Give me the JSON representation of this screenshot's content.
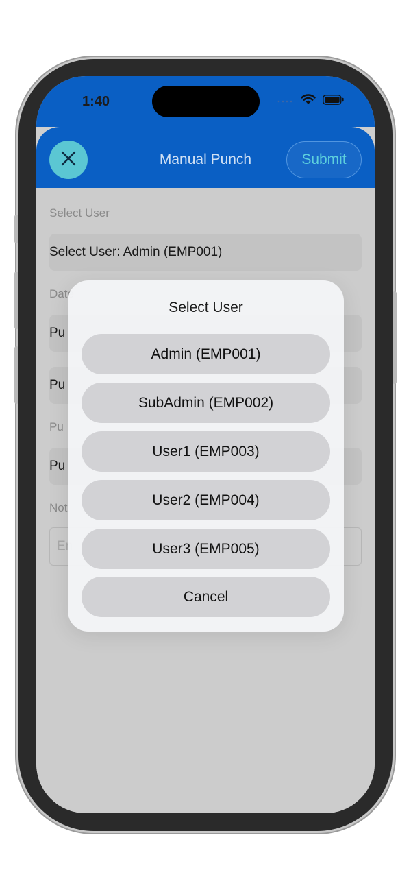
{
  "status_bar": {
    "time": "1:40"
  },
  "nav": {
    "title": "Manual Punch",
    "submit_label": "Submit",
    "close_icon": "close-icon"
  },
  "form": {
    "select_user_label": "Select User",
    "select_user_value": "Select User: Admin (EMP001)",
    "date_label": "Date",
    "punch_in_value": "Pu",
    "punch_out_value": "Pu",
    "punch_type_label": "Pu",
    "punch_type_value": "Pu",
    "notes_label": "Not",
    "notes_placeholder": "En"
  },
  "picker": {
    "title": "Select User",
    "options": [
      {
        "label": "Admin (EMP001)"
      },
      {
        "label": "SubAdmin (EMP002)"
      },
      {
        "label": "User1 (EMP003)"
      },
      {
        "label": "User2 (EMP004)"
      },
      {
        "label": "User3 (EMP005)"
      }
    ],
    "cancel_label": "Cancel"
  },
  "colors": {
    "nav_blue": "#0a5fc4",
    "close_button": "#5bc7d3",
    "submit_text": "#5dd0dd",
    "sheet_bg": "#cccccc"
  }
}
